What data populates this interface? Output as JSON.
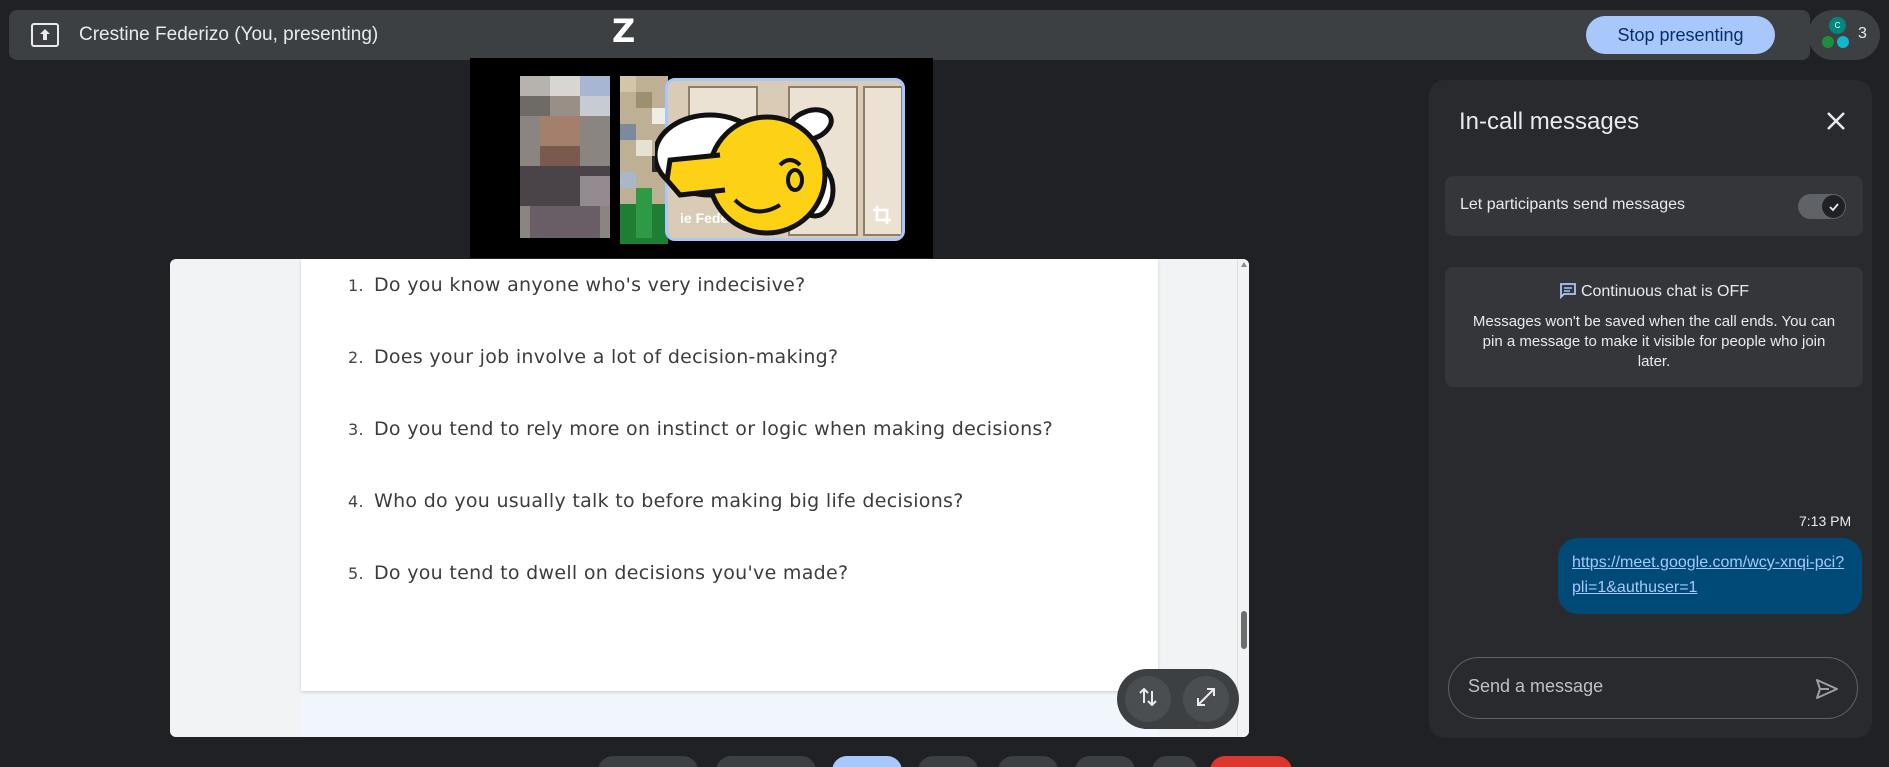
{
  "topbar": {
    "presenter_title": "Crestine Federizo (You, presenting)",
    "stop_label": "Stop presenting",
    "participant_count": "3",
    "avatar_initials": [
      "C",
      "",
      ""
    ],
    "icons": [
      "present-to-all-icon",
      "avatar-icon"
    ]
  },
  "preview": {
    "self_name": "ie Feder",
    "sticker_text": "Z",
    "icons": [
      "crop-icon"
    ]
  },
  "document": {
    "questions": [
      {
        "num": "1.",
        "text": "Do you know anyone who's very indecisive?"
      },
      {
        "num": "2.",
        "text": "Does your job involve a lot of decision-making?"
      },
      {
        "num": "3.",
        "text": "Do you tend to rely more on instinct or logic when making decisions?"
      },
      {
        "num": "4.",
        "text": "Who do you usually talk to before making big life decisions?"
      },
      {
        "num": "5.",
        "text": "Do you tend to dwell on decisions you've made?"
      }
    ],
    "controls": [
      "swap-icon",
      "expand-icon"
    ]
  },
  "chat": {
    "title": "In-call messages",
    "toggle_label": "Let participants send messages",
    "toggle_on": true,
    "continuous_heading": "Continuous chat is OFF",
    "continuous_body": "Messages won't be saved when the call ends. You can pin a message to make it visible for people who join later.",
    "messages": [
      {
        "time": "7:13 PM",
        "text": "https://meet.google.com/wcy-xnqi-pci?pli=1&authuser=1"
      }
    ],
    "input_placeholder": "Send a message"
  },
  "colors": {
    "background": "#202124",
    "bar": "#3c4043",
    "accent": "#a8c7fa",
    "bubble": "#004a77",
    "panel": "#292a2d"
  }
}
